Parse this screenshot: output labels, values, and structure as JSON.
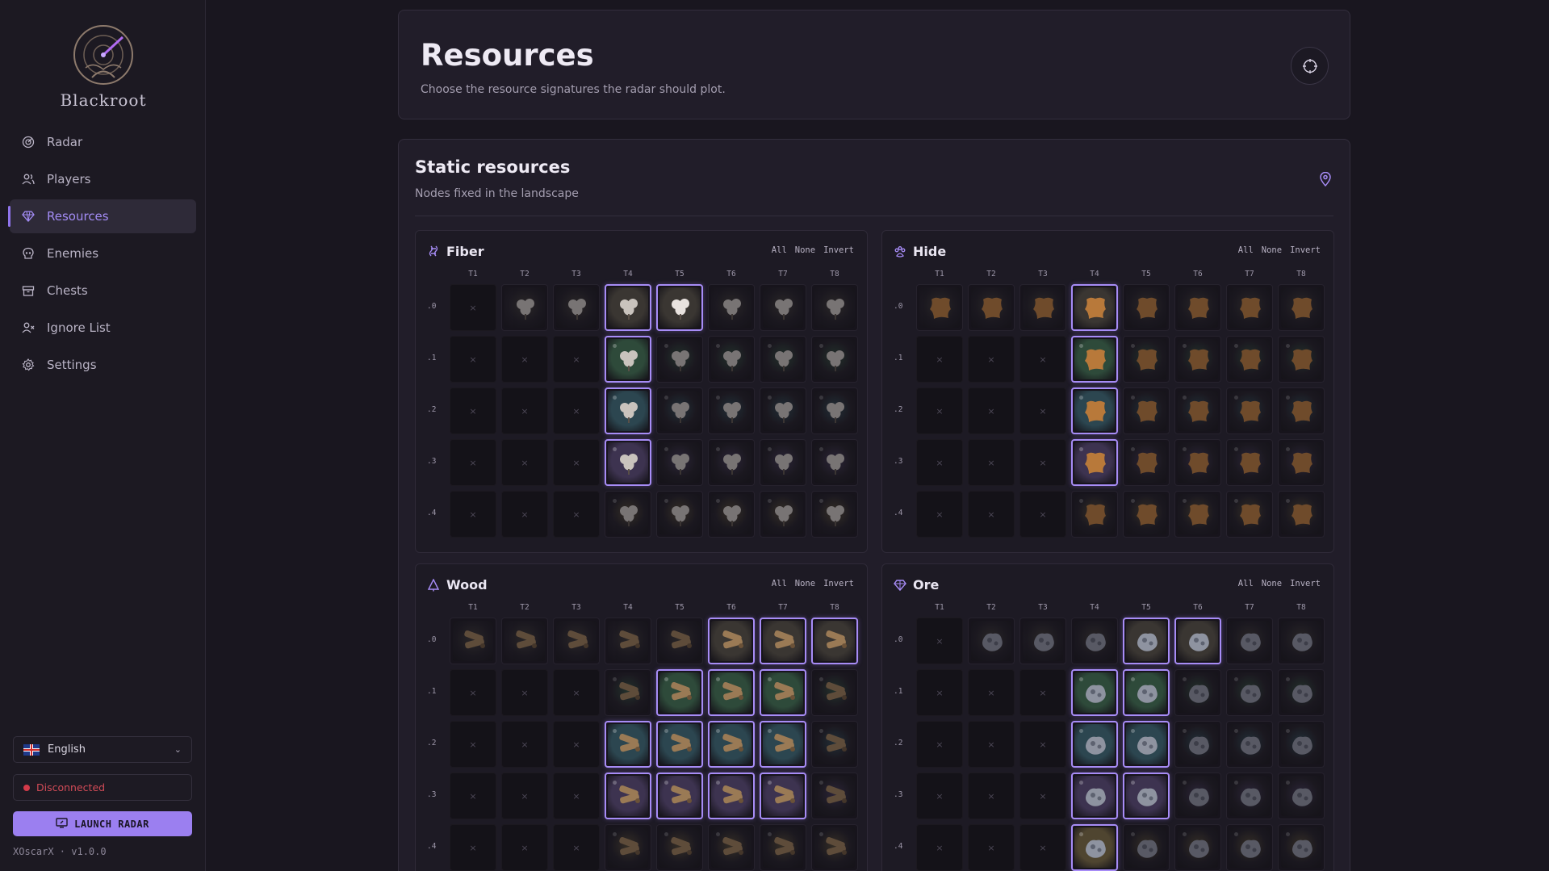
{
  "app": {
    "logo_text": "Blackroot",
    "version": "XOscarX · v1.0.0"
  },
  "sidebar": {
    "items": [
      {
        "label": "Radar",
        "icon": "radar-icon",
        "active": false
      },
      {
        "label": "Players",
        "icon": "players-icon",
        "active": false
      },
      {
        "label": "Resources",
        "icon": "gem-icon",
        "active": true
      },
      {
        "label": "Enemies",
        "icon": "enemy-icon",
        "active": false
      },
      {
        "label": "Chests",
        "icon": "chest-icon",
        "active": false
      },
      {
        "label": "Ignore List",
        "icon": "user-x-icon",
        "active": false
      },
      {
        "label": "Settings",
        "icon": "gear-icon",
        "active": false
      }
    ],
    "language": "English",
    "connection_status": "Disconnected",
    "launch_label": "LAUNCH RADAR"
  },
  "header": {
    "title": "Resources",
    "subtitle": "Choose the resource signatures the radar should plot."
  },
  "static": {
    "title": "Static resources",
    "subtitle": "Nodes fixed in the landscape"
  },
  "tiers": [
    "T1",
    "T2",
    "T3",
    "T4",
    "T5",
    "T6",
    "T7",
    "T8"
  ],
  "enchants": [
    ".0",
    ".1",
    ".2",
    ".3",
    ".4"
  ],
  "actions": {
    "all": "All",
    "none": "None",
    "invert": "Invert"
  },
  "colors": {
    "accent": "#9b7ff0",
    "selected_border": "#a78cf6",
    "disconnected": "#d33a49",
    "ench_tints": [
      "#3a3632",
      "#2e4a3a",
      "#2c4650",
      "#3d3350",
      "#4f4530"
    ]
  },
  "groups": [
    {
      "key": "fiber",
      "label": "Fiber",
      "icon": "fiber-icon",
      "base_color": "#c9c3bd",
      "selected": [
        [
          false,
          false,
          false,
          true,
          true,
          false,
          false,
          false
        ],
        [
          false,
          false,
          false,
          true,
          false,
          false,
          false,
          false
        ],
        [
          false,
          false,
          false,
          true,
          false,
          false,
          false,
          false
        ],
        [
          false,
          false,
          false,
          true,
          false,
          false,
          false,
          false
        ],
        [
          false,
          false,
          false,
          false,
          false,
          false,
          false,
          false
        ]
      ]
    },
    {
      "key": "hide",
      "label": "Hide",
      "icon": "paw-icon",
      "base_color": "#b8793a",
      "selected": [
        [
          false,
          false,
          false,
          true,
          false,
          false,
          false,
          false
        ],
        [
          false,
          false,
          false,
          true,
          false,
          false,
          false,
          false
        ],
        [
          false,
          false,
          false,
          true,
          false,
          false,
          false,
          false
        ],
        [
          false,
          false,
          false,
          true,
          false,
          false,
          false,
          false
        ],
        [
          false,
          false,
          false,
          false,
          false,
          false,
          false,
          false
        ]
      ]
    },
    {
      "key": "wood",
      "label": "Wood",
      "icon": "tree-icon",
      "base_color": "#9a7a55",
      "selected": [
        [
          false,
          false,
          false,
          false,
          false,
          true,
          true,
          true
        ],
        [
          false,
          false,
          false,
          false,
          true,
          true,
          true,
          false
        ],
        [
          false,
          false,
          false,
          true,
          true,
          true,
          true,
          false
        ],
        [
          false,
          false,
          false,
          true,
          true,
          true,
          true,
          false
        ],
        [
          false,
          false,
          false,
          false,
          false,
          false,
          false,
          false
        ]
      ]
    },
    {
      "key": "ore",
      "label": "Ore",
      "icon": "ore-gem-icon",
      "base_color": "#8e93a0",
      "selected": [
        [
          false,
          false,
          false,
          false,
          true,
          true,
          false,
          false
        ],
        [
          false,
          false,
          false,
          true,
          true,
          false,
          false,
          false
        ],
        [
          false,
          false,
          false,
          true,
          true,
          false,
          false,
          false
        ],
        [
          false,
          false,
          false,
          true,
          true,
          false,
          false,
          false
        ],
        [
          false,
          false,
          false,
          true,
          false,
          false,
          false,
          false
        ]
      ]
    }
  ]
}
